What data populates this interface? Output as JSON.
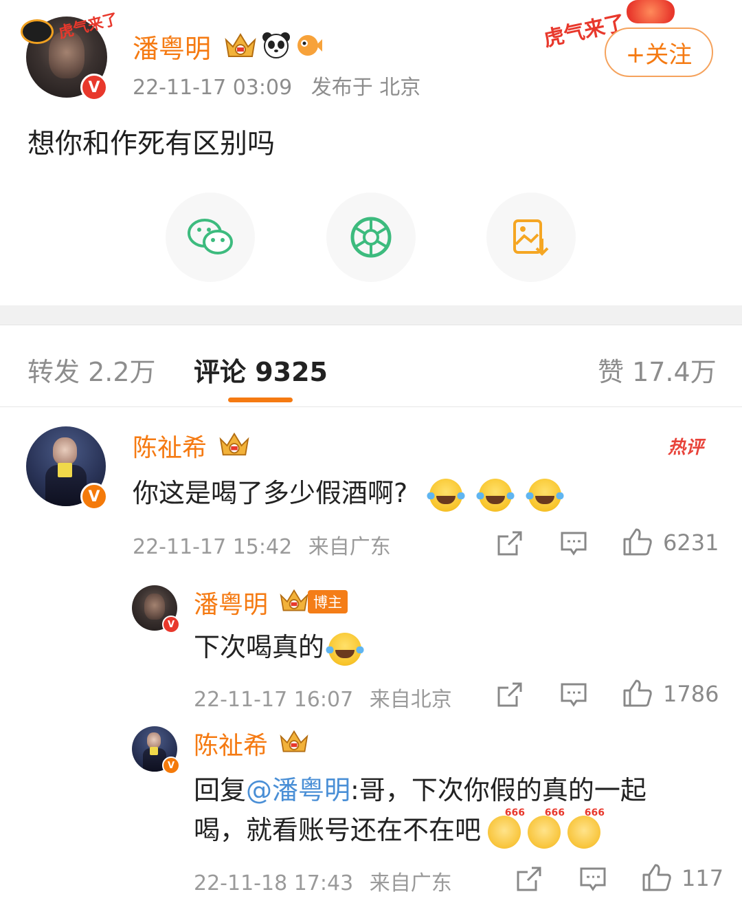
{
  "post": {
    "author": "潘粤明",
    "timestamp": "22-11-17 03:09",
    "location": "发布于 北京",
    "text": "想你和作死有区别吗",
    "follow_label": "+关注",
    "avatar_pendant": "虎气来了",
    "corner_decoration": "虎气来了"
  },
  "share": [
    {
      "icon": "wechat-icon",
      "color": "#3dbb7e"
    },
    {
      "icon": "moments-aperture-icon",
      "color": "#3dbb7e"
    },
    {
      "icon": "save-image-icon",
      "color": "#f5a623"
    }
  ],
  "tabs": {
    "repost": "转发 2.2万",
    "comments": "评论 9325",
    "likes": "赞 17.4万"
  },
  "comments": [
    {
      "author": "陈祉希",
      "text": "你这是喝了多少假酒啊?",
      "emoji_count": 3,
      "badge": "热评",
      "time": "22-11-17 15:42",
      "from": "来自广东",
      "likes": "6231"
    },
    {
      "author": "潘粤明",
      "tag": "博主",
      "text": "下次喝真的",
      "time": "22-11-17 16:07",
      "from": "来自北京",
      "likes": "1786"
    },
    {
      "author": "陈祉希",
      "reply_prefix": "回复",
      "mention": "@潘粤明",
      "text_line1": ":哥，下次你假的真的一起",
      "text_line2": "喝，就看账号还在不在吧",
      "emoji_label": "666",
      "time": "22-11-18 17:43",
      "from": "来自广东",
      "likes": "117"
    }
  ],
  "colors": {
    "accent": "#f57a12",
    "link": "#4a8fd6",
    "muted": "#8d8d8d"
  }
}
